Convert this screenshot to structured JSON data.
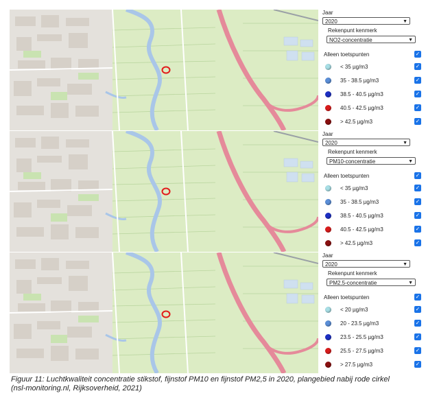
{
  "panels": [
    {
      "year_label": "Jaar",
      "year_value": "2020",
      "kenmerk_label": "Rekenpunt kenmerk",
      "kenmerk_value": "NO2-concentratie",
      "toetspunten_label": "Alleen toetspunten",
      "legend": [
        {
          "label": "< 35 µg/m3",
          "color": "#a8dfe6"
        },
        {
          "label": "35 - 38.5 µg/m3",
          "color": "#5b8fd8"
        },
        {
          "label": "38.5 - 40.5 µg/m3",
          "color": "#1d2fc4"
        },
        {
          "label": "40.5 - 42.5 µg/m3",
          "color": "#d91c1c"
        },
        {
          "label": "> 42.5 µg/m3",
          "color": "#8a1010"
        }
      ]
    },
    {
      "year_label": "Jaar",
      "year_value": "2020",
      "kenmerk_label": "Rekenpunt kenmerk",
      "kenmerk_value": "PM10-concentratie",
      "toetspunten_label": "Alleen toetspunten",
      "legend": [
        {
          "label": "< 35 µg/m3",
          "color": "#a8dfe6"
        },
        {
          "label": "35 - 38.5 µg/m3",
          "color": "#5b8fd8"
        },
        {
          "label": "38.5 - 40.5 µg/m3",
          "color": "#1d2fc4"
        },
        {
          "label": "40.5 - 42.5 µg/m3",
          "color": "#d91c1c"
        },
        {
          "label": "> 42.5 µg/m3",
          "color": "#8a1010"
        }
      ]
    },
    {
      "year_label": "Jaar",
      "year_value": "2020",
      "kenmerk_label": "Rekenpunt kenmerk",
      "kenmerk_value": "PM2.5-concentratie",
      "toetspunten_label": "Alleen toetspunten",
      "legend": [
        {
          "label": "< 20 µg/m3",
          "color": "#a8dfe6"
        },
        {
          "label": "20 - 23.5 µg/m3",
          "color": "#5b8fd8"
        },
        {
          "label": "23.5 - 25.5 µg/m3",
          "color": "#1d2fc4"
        },
        {
          "label": "25.5 - 27.5 µg/m3",
          "color": "#d91c1c"
        },
        {
          "label": "> 27.5 µg/m3",
          "color": "#8a1010"
        }
      ]
    }
  ],
  "caption": {
    "line1": "Figuur 11: Luchtkwaliteit concentratie stikstof, fijnstof PM10 en fijnstof PM2,5 in 2020, plangebied nabij rode cirkel",
    "line2": "(nsl-monitoring.nl, Rijksoverheid, 2021)"
  },
  "colors": {
    "checkbox": "#1a73e8",
    "marker": "#e21b1b",
    "highway": "#e58a9a",
    "canal": "#a9c6e8",
    "land": "#d9ecc0"
  }
}
